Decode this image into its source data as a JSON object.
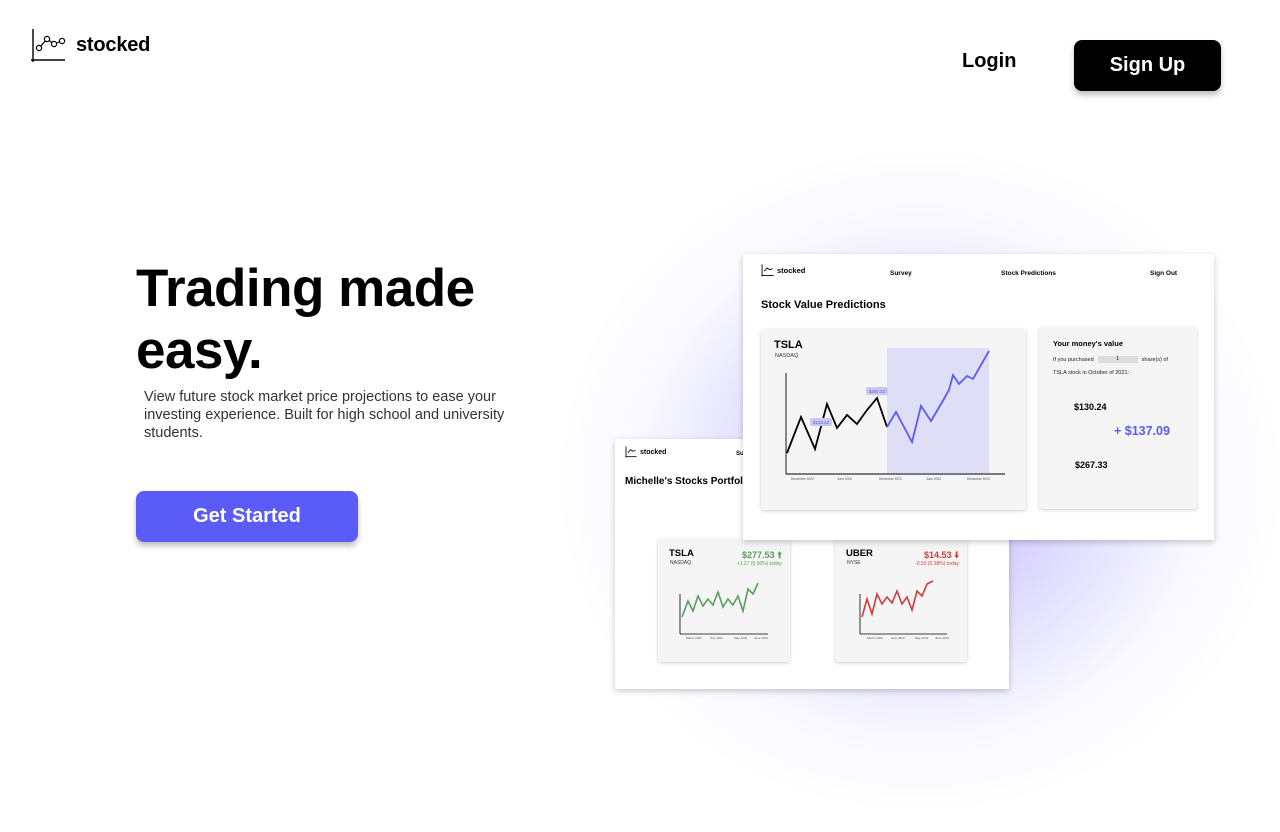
{
  "header": {
    "brand": "stocked",
    "login_label": "Login",
    "signup_label": "Sign Up"
  },
  "hero": {
    "title_line1": "Trading made",
    "title_line2": "easy.",
    "subtitle": "View future stock market price projections to ease your investing experience. Built for high school and university students.",
    "cta_label": "Get Started"
  },
  "colors": {
    "accent": "#5b5bf7",
    "gain_green": "#5a9e5a",
    "loss_red": "#d13b3b"
  },
  "portfolio_preview": {
    "brand": "stocked",
    "nav_partial": "Su",
    "title": "Michelle's Stocks Portfolio",
    "stocks": [
      {
        "ticker": "TSLA",
        "exchange": "NASDAQ",
        "price": "$277.53",
        "direction_icon": "arrow-up-icon",
        "change": "+1.27 (0.50%) today"
      },
      {
        "ticker": "UBER",
        "exchange": "NYSE",
        "price": "$14.53",
        "direction_icon": "arrow-down-icon",
        "change": "-0.50 (0.38%) today"
      }
    ]
  },
  "predictions_preview": {
    "brand": "stocked",
    "nav": [
      "Survey",
      "Stock Predictions",
      "Sign Out"
    ],
    "title": "Stock Value Predictions",
    "chart": {
      "ticker": "TSLA",
      "exchange": "NASDAQ",
      "tooltip_low": "$133.42",
      "tooltip_high": "$267.33"
    },
    "money": {
      "title": "Your money's value",
      "line1_prefix": "If you purchased",
      "shares": "1",
      "line1_suffix": "share(s) of",
      "line2": "TSLA stock in October of 2021:",
      "purchase_value": "$130.24",
      "gain": "+ $137.09",
      "current_value": "$267.33"
    }
  }
}
